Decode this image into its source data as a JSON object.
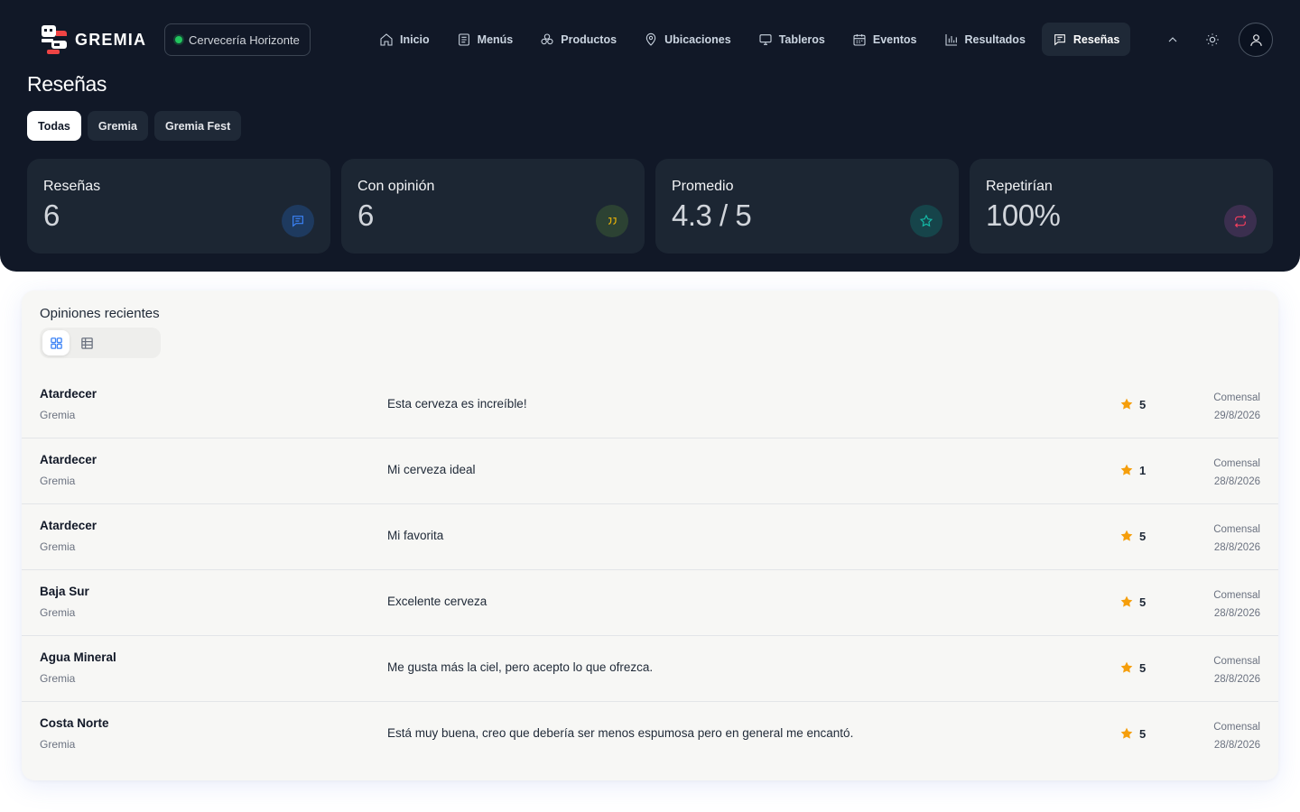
{
  "app": {
    "name": "GREMIA",
    "brewery": "Cervecería Horizonte"
  },
  "nav": {
    "items": [
      {
        "label": "Inicio",
        "icon": "home-icon"
      },
      {
        "label": "Menús",
        "icon": "menu-list-icon"
      },
      {
        "label": "Productos",
        "icon": "products-icon"
      },
      {
        "label": "Ubicaciones",
        "icon": "location-pin-icon"
      },
      {
        "label": "Tableros",
        "icon": "monitor-icon"
      },
      {
        "label": "Eventos",
        "icon": "calendar-icon"
      },
      {
        "label": "Resultados",
        "icon": "bar-chart-icon"
      },
      {
        "label": "Reseñas",
        "icon": "reviews-icon",
        "active": true
      }
    ]
  },
  "page": {
    "title": "Reseñas"
  },
  "filters": [
    {
      "label": "Todas",
      "active": true
    },
    {
      "label": "Gremia"
    },
    {
      "label": "Gremia Fest"
    }
  ],
  "stats": [
    {
      "label": "Reseñas",
      "value": "6",
      "icon": "message-icon",
      "color": "#3b82f6"
    },
    {
      "label": "Con opinión",
      "value": "6",
      "icon": "quote-icon",
      "color": "#eab308"
    },
    {
      "label": "Promedio",
      "value": "4.3 / 5",
      "icon": "star-icon",
      "color": "#14b8a6"
    },
    {
      "label": "Repetirían",
      "value": "100%",
      "icon": "repeat-icon",
      "color": "#f43f5e"
    }
  ],
  "recent": {
    "title": "Opiniones recientes",
    "view": {
      "active": "grid",
      "options": [
        "grid-icon",
        "table-icon"
      ]
    },
    "reviews": [
      {
        "beer": "Atardecer",
        "brand": "Gremia",
        "comment": "Esta cerveza es increíble!",
        "rating": "5",
        "author": "Comensal",
        "date": "29/8/2026"
      },
      {
        "beer": "Atardecer",
        "brand": "Gremia",
        "comment": "Mi cerveza ideal",
        "rating": "1",
        "author": "Comensal",
        "date": "28/8/2026"
      },
      {
        "beer": "Atardecer",
        "brand": "Gremia",
        "comment": "Mi favorita",
        "rating": "5",
        "author": "Comensal",
        "date": "28/8/2026"
      },
      {
        "beer": "Baja Sur",
        "brand": "Gremia",
        "comment": "Excelente cerveza",
        "rating": "5",
        "author": "Comensal",
        "date": "28/8/2026"
      },
      {
        "beer": "Agua Mineral",
        "brand": "Gremia",
        "comment": "Me gusta más la ciel, pero acepto lo que ofrezca.",
        "rating": "5",
        "author": "Comensal",
        "date": "28/8/2026"
      },
      {
        "beer": "Costa Norte",
        "brand": "Gremia",
        "comment": "Está muy buena, creo que debería ser menos espumosa pero en general me encantó.",
        "rating": "5",
        "author": "Comensal",
        "date": "28/8/2026"
      }
    ]
  },
  "colors": {
    "hero_bg": "#111827",
    "card_bg": "#1c2633",
    "star": "#f59e0b",
    "accent_blue": "#3b82f6"
  }
}
